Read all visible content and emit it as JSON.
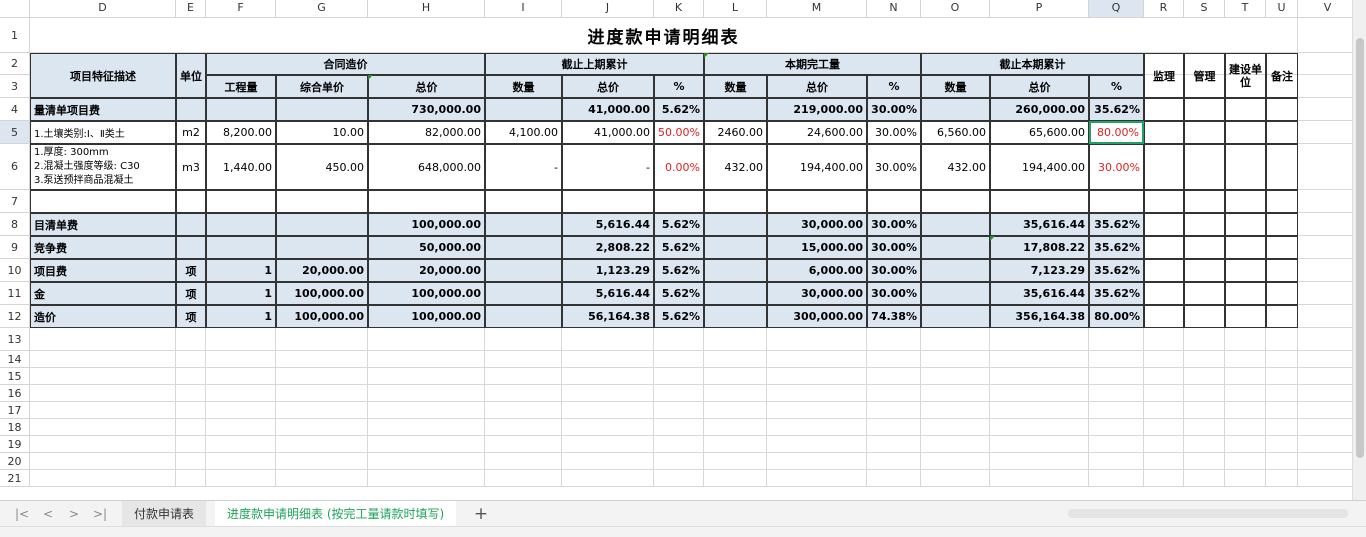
{
  "columns": [
    "D",
    "E",
    "F",
    "G",
    "H",
    "I",
    "J",
    "K",
    "L",
    "M",
    "N",
    "O",
    "P",
    "Q",
    "R",
    "S",
    "T",
    "U",
    "V"
  ],
  "rows": [
    "1",
    "2",
    "3",
    "4",
    "5",
    "6",
    "7",
    "8",
    "9",
    "10",
    "11",
    "12",
    "13",
    "14",
    "15",
    "16",
    "17",
    "18",
    "19",
    "20",
    "21"
  ],
  "title": "进度款申请明细表",
  "header": {
    "desc": "项目特征描述",
    "unit": "单位",
    "contract": "合同造价",
    "prev": "截止上期累计",
    "current": "本期完工量",
    "cumulative": "截止本期累计",
    "qty": "工程量",
    "unit_price": "综合单价",
    "total": "总价",
    "num": "数量",
    "subtotal": "总价",
    "pct": "%",
    "supervisor": "监理",
    "manage": "管理",
    "owner": "建设单位",
    "remark": "备注"
  },
  "table_rows": [
    {
      "d": "量清单项目费",
      "e": "",
      "f": "",
      "g": "",
      "h": "730,000.00",
      "i": "",
      "j": "41,000.00",
      "k": "5.62%",
      "l": "",
      "m": "219,000.00",
      "n": "30.00%",
      "o": "",
      "p": "260,000.00",
      "q": "35.62%"
    },
    {
      "d": "1.土壤类别:Ⅰ、Ⅱ类土",
      "e": "m2",
      "f": "8,200.00",
      "g": "10.00",
      "h": "82,000.00",
      "i": "4,100.00",
      "j": "41,000.00",
      "k": "50.00%",
      "l": "2460.00",
      "m": "24,600.00",
      "n": "30.00%",
      "o": "6,560.00",
      "p": "65,600.00",
      "q": "80.00%"
    },
    {
      "d1": "1.厚度: 300mm",
      "d2": "2.混凝土强度等级: C30",
      "d3": "3.泵送预拌商品混凝土",
      "e": "m3",
      "f": "1,440.00",
      "g": "450.00",
      "h": "648,000.00",
      "i": "-",
      "j": "-",
      "k": "0.00%",
      "l": "432.00",
      "m": "194,400.00",
      "n": "30.00%",
      "o": "432.00",
      "p": "194,400.00",
      "q": "30.00%"
    },
    {},
    {
      "d": "目清单费",
      "h": "100,000.00",
      "j": "5,616.44",
      "k": "5.62%",
      "m": "30,000.00",
      "n": "30.00%",
      "p": "35,616.44",
      "q": "35.62%"
    },
    {
      "d": "竞争费",
      "h": "50,000.00",
      "j": "2,808.22",
      "k": "5.62%",
      "m": "15,000.00",
      "n": "30.00%",
      "p": "17,808.22",
      "q": "35.62%"
    },
    {
      "d": "项目费",
      "e": "项",
      "f": "1",
      "g": "20,000.00",
      "h": "20,000.00",
      "j": "1,123.29",
      "k": "5.62%",
      "m": "6,000.00",
      "n": "30.00%",
      "p": "7,123.29",
      "q": "35.62%"
    },
    {
      "d": "金",
      "e": "项",
      "f": "1",
      "g": "100,000.00",
      "h": "100,000.00",
      "j": "5,616.44",
      "k": "5.62%",
      "m": "30,000.00",
      "n": "30.00%",
      "p": "35,616.44",
      "q": "35.62%"
    },
    {
      "d": "造价",
      "e": "项",
      "f": "1",
      "g": "100,000.00",
      "h": "100,000.00",
      "j": "56,164.38",
      "k": "5.62%",
      "m": "300,000.00",
      "n": "74.38%",
      "p": "356,164.38",
      "q": "80.00%"
    }
  ],
  "tabs": [
    "付款申请表",
    "进度款申请明细表 (按完工量请款时填写)"
  ],
  "add_tab": "+",
  "colors": {
    "header_blue": "#dce6f1",
    "active_tab": "#1fa35b",
    "select_border": "#21a366"
  }
}
